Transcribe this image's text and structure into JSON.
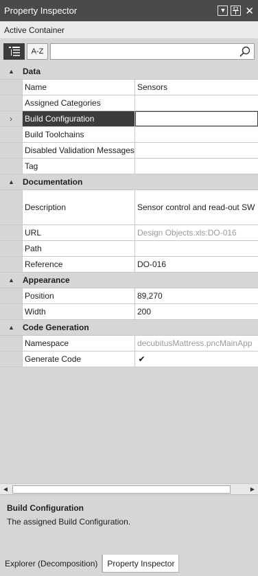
{
  "window": {
    "title": "Property Inspector",
    "subheader": "Active Container"
  },
  "toolbar": {
    "categorized_icon": "categorized-list-icon",
    "alphabetical_label": "A-Z",
    "search_value": "",
    "search_placeholder": "",
    "search_icon": "search-icon"
  },
  "categories": [
    {
      "label": "Data",
      "rows": [
        {
          "name": "Name",
          "value": "Sensors"
        },
        {
          "name": "Assigned Categories",
          "value": ""
        },
        {
          "name": "Build Configuration",
          "value": "",
          "selected": true
        },
        {
          "name": "Build Toolchains",
          "value": ""
        },
        {
          "name": "Disabled Validation Messages",
          "value": ""
        },
        {
          "name": "Tag",
          "value": ""
        }
      ]
    },
    {
      "label": "Documentation",
      "rows": [
        {
          "name": "Description",
          "value": "Sensor control and read-out SW",
          "tall": true
        },
        {
          "name": "URL",
          "value": "Design Objects.xls:DO-016",
          "muted": true
        },
        {
          "name": "Path",
          "value": ""
        },
        {
          "name": "Reference",
          "value": "DO-016"
        }
      ]
    },
    {
      "label": "Appearance",
      "rows": [
        {
          "name": "Position",
          "value": "89,270"
        },
        {
          "name": "Width",
          "value": "200"
        }
      ]
    },
    {
      "label": "Code Generation",
      "rows": [
        {
          "name": "Namespace",
          "value": "decubitusMattress.pncMainApp",
          "muted": true
        },
        {
          "name": "Generate Code",
          "value": "",
          "checkbox": true,
          "checked": true
        }
      ]
    }
  ],
  "description_panel": {
    "title": "Build Configuration",
    "text": "The assigned Build Configuration."
  },
  "tabs": [
    {
      "label": "Explorer (Decomposition)",
      "active": false
    },
    {
      "label": "Property Inspector",
      "active": true
    }
  ]
}
